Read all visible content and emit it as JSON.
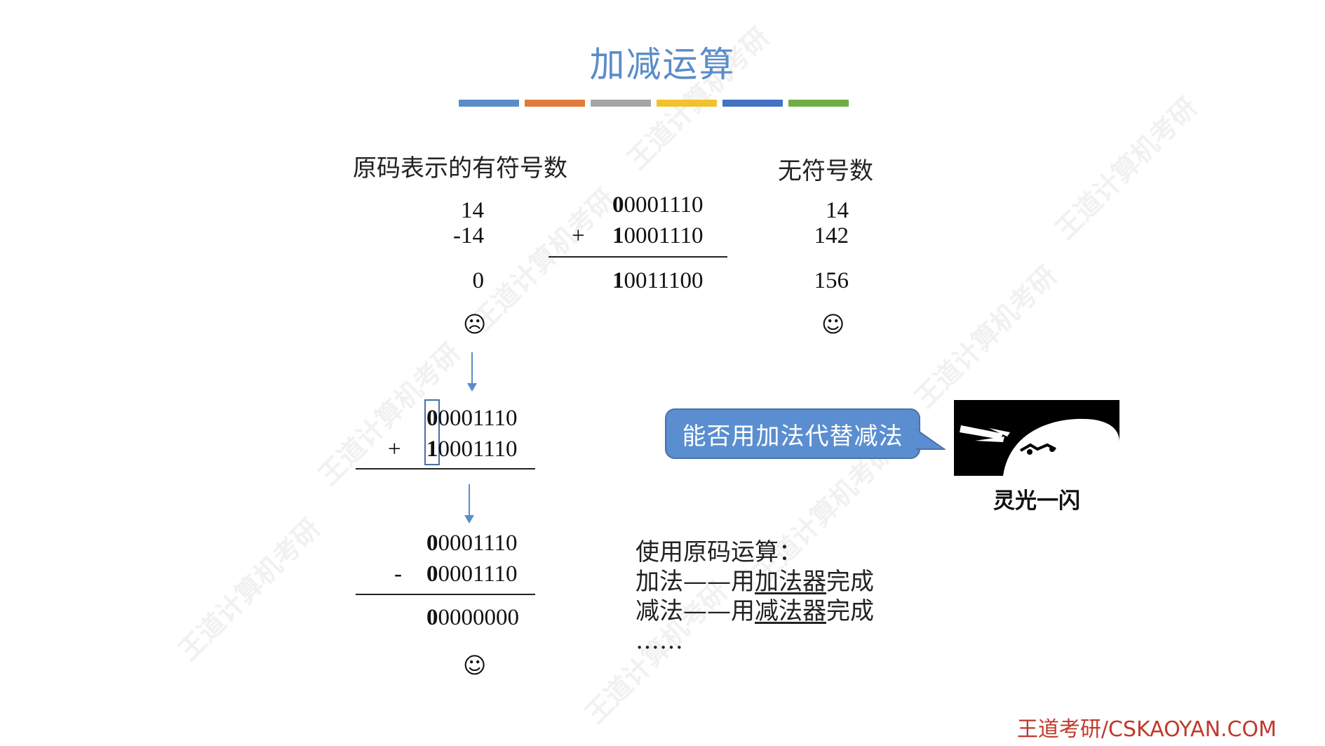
{
  "title": "加减运算",
  "accent_colors": [
    "#5b8cc8",
    "#e07b39",
    "#a5a5a5",
    "#f2c12e",
    "#4472c4",
    "#70ad47"
  ],
  "left_heading": "原码表示的有符号数",
  "right_heading": "无符号数",
  "top_example": {
    "signed_values": [
      "14",
      "-14",
      "0"
    ],
    "binary_a": {
      "lead": "0",
      "rest": "0001110"
    },
    "operator": "+",
    "binary_b": {
      "lead": "1",
      "rest": "0001110"
    },
    "binary_result": {
      "lead": "1",
      "rest": "0011100"
    },
    "unsigned_values": [
      "14",
      "142",
      "156"
    ],
    "signed_face": "☹",
    "unsigned_face": "☺"
  },
  "middle_example": {
    "binary_a": {
      "lead": "0",
      "rest": "0001110"
    },
    "operator": "+",
    "binary_b": {
      "lead": "1",
      "rest": "0001110"
    }
  },
  "bottom_example": {
    "binary_a": {
      "lead": "0",
      "rest": "0001110"
    },
    "operator": "-",
    "binary_b": {
      "lead": "0",
      "rest": "0001110"
    },
    "binary_result": {
      "lead": "0",
      "rest": "0000000"
    },
    "face": "☺"
  },
  "bubble_text": "能否用加法代替减法",
  "meme_caption": "灵光一闪",
  "description": {
    "heading": "使用原码运算：",
    "line1": {
      "prefix": "加法——用",
      "underlined": "加法器",
      "suffix": "完成"
    },
    "line2": {
      "prefix": "减法——用",
      "underlined": "减法器",
      "suffix": "完成"
    },
    "ellipsis": "……"
  },
  "footer": "王道考研/CSKAOYAN.COM",
  "watermark": "王道计算机考研"
}
